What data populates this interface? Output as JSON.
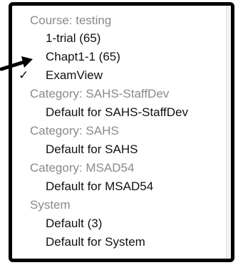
{
  "menu": {
    "groups": [
      {
        "label": "Course: testing",
        "options": [
          "1-trial (65)",
          "Chapt1-1 (65)",
          "ExamView"
        ]
      },
      {
        "label": "Category: SAHS-StaffDev",
        "options": [
          "Default for SAHS-StaffDev"
        ]
      },
      {
        "label": "Category: SAHS",
        "options": [
          "Default for SAHS"
        ]
      },
      {
        "label": "Category: MSAD54",
        "options": [
          "Default for MSAD54"
        ]
      },
      {
        "label": "System",
        "options": [
          "Default (3)",
          "Default for System"
        ]
      }
    ],
    "selected_option": "ExamView",
    "checkmark": "✓"
  },
  "icons": {
    "checkmark": "checkmark-icon",
    "pointer": "arrow-pointer-icon"
  },
  "colors": {
    "frame_border": "#000000",
    "group_label": "#8a8a8a",
    "option_text": "#111111",
    "pointer": "#000000"
  }
}
